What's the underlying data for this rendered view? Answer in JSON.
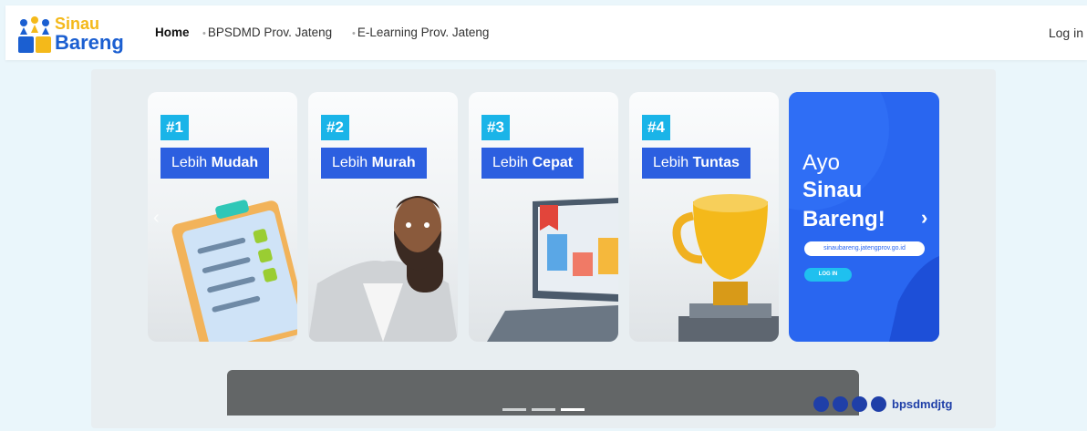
{
  "brand": {
    "line1": "Sinau",
    "line2": "Bareng"
  },
  "nav": {
    "home": "Home",
    "bpsdmd": "BPSDMD Prov. Jateng",
    "elearning": "E-Learning Prov. Jateng",
    "login": "Log in"
  },
  "slides": [
    {
      "number": "#1",
      "prefix": "Lebih",
      "word": "Mudah",
      "art": "clipboard-checklist"
    },
    {
      "number": "#2",
      "prefix": "Lebih",
      "word": "Murah",
      "art": "bearded-man"
    },
    {
      "number": "#3",
      "prefix": "Lebih",
      "word": "Cepat",
      "art": "laptop-chart"
    },
    {
      "number": "#4",
      "prefix": "Lebih",
      "word": "Tuntas",
      "art": "gold-trophy"
    }
  ],
  "promo": {
    "line1": "Ayo",
    "line2": "Sinau",
    "line3": "Bareng!",
    "url": "sinaubareng.jatengprov.go.id",
    "login": "LOG IN"
  },
  "carousel": {
    "slide_count": 3,
    "active_slide": 3
  },
  "social": {
    "handle": "bpsdmdjtg",
    "icons": [
      "facebook-icon",
      "instagram-icon",
      "twitter-icon",
      "youtube-icon"
    ]
  },
  "colors": {
    "accent_blue": "#2c5fe0",
    "badge_cyan": "#1ab4e8",
    "brand_yellow": "#f4b91a",
    "promo_blue": "#2966f0"
  }
}
